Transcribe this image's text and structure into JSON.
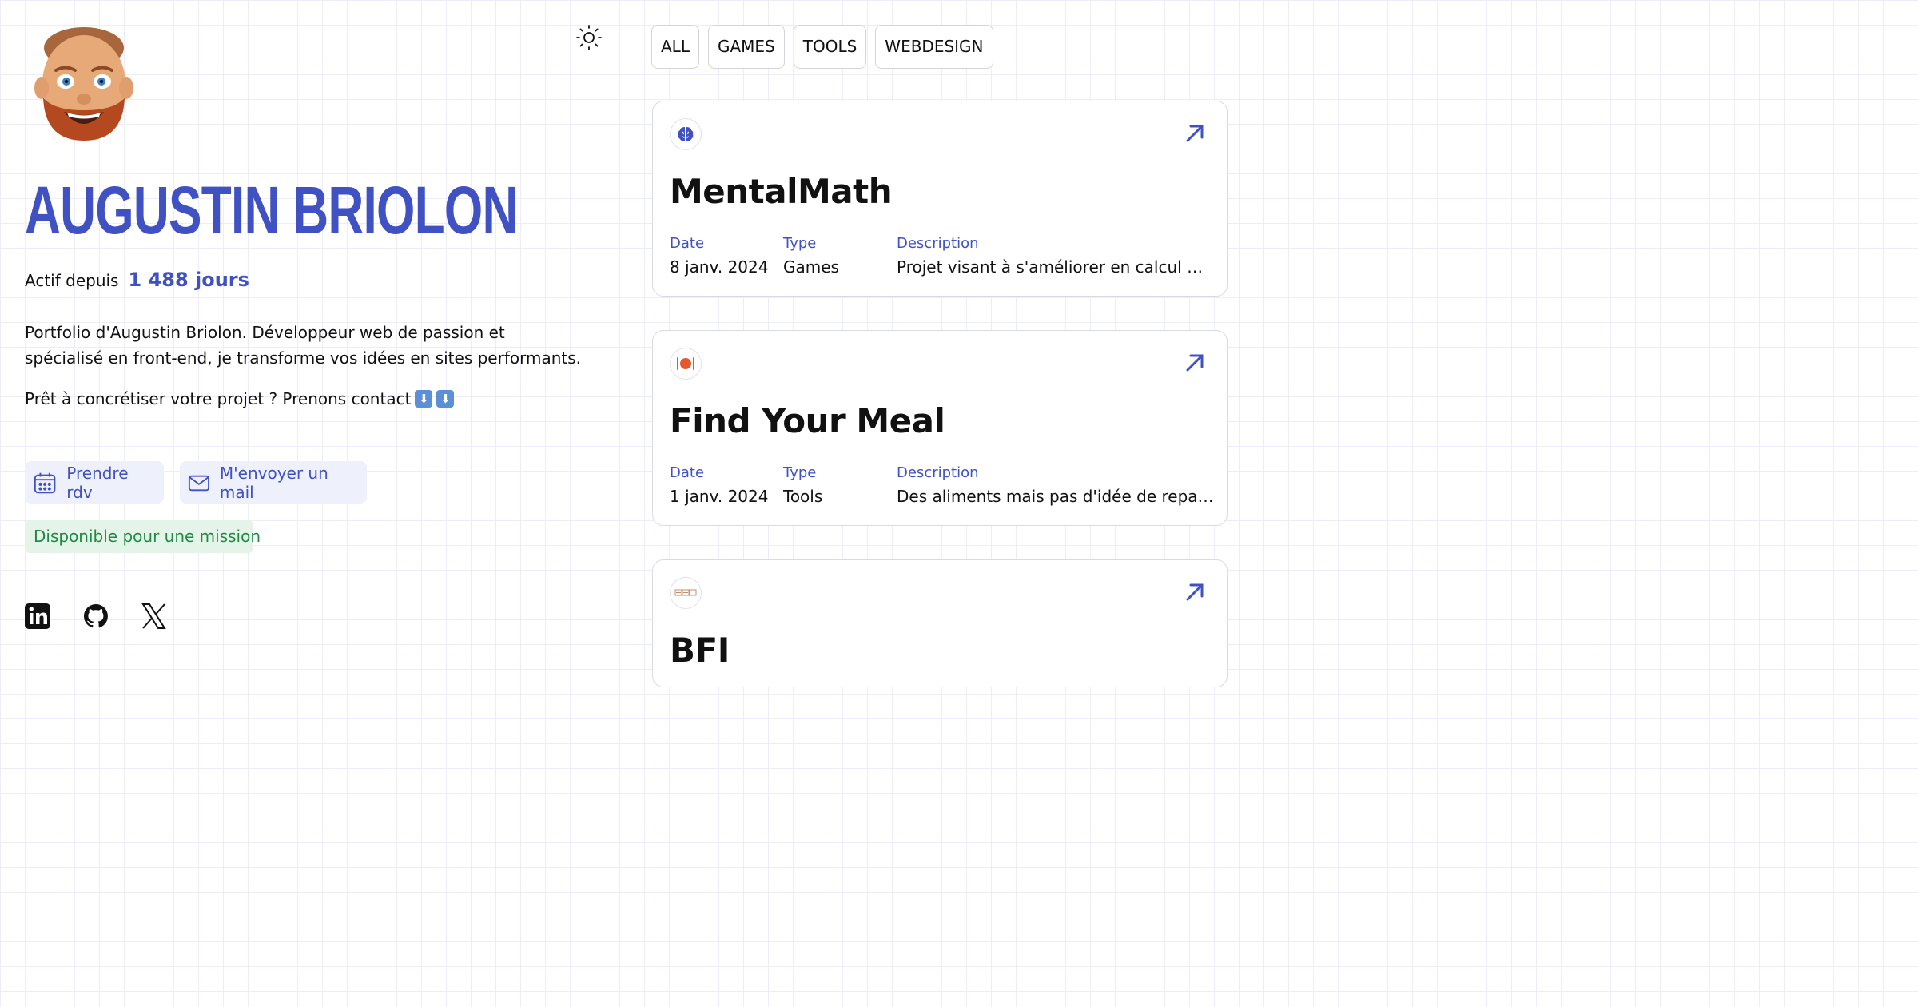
{
  "profile": {
    "name": "AUGUSTIN BRIOLON",
    "since_label": "Actif depuis",
    "since_value": "1 488 jours",
    "bio": "Portfolio d'Augustin Briolon. Développeur web de passion et spécialisé en front-end, je transforme vos idées en sites performants.",
    "cta_text": "Prêt à concrétiser votre projet ? Prenons contact",
    "cta_emoji": "⬇",
    "book_label": "Prendre rdv",
    "mail_label": "M'envoyer un mail",
    "availability": "Disponible pour une mission"
  },
  "social": [
    "linkedin-icon",
    "github-icon",
    "x-icon"
  ],
  "theme_toggle_icon": "sun-icon",
  "filters": [
    "ALL",
    "GAMES",
    "TOOLS",
    "WEBDESIGN"
  ],
  "labels": {
    "date": "Date",
    "type": "Type",
    "description": "Description"
  },
  "projects": [
    {
      "icon": "brain-icon",
      "title": "MentalMath",
      "date": "8 janv. 2024",
      "type": "Games",
      "description": "Projet visant à s'améliorer en calcul mental rapidement."
    },
    {
      "icon": "plate-icon",
      "title": "Find Your Meal",
      "date": "1 janv. 2024",
      "type": "Tools",
      "description": "Des aliments mais pas d'idée de repas ? Trouvez une recette."
    },
    {
      "icon": "logo-icon",
      "title": "BFI"
    }
  ],
  "colors": {
    "accent": "#3f51c3",
    "available_bg": "#e5f4e8",
    "available_text": "#1f8a46",
    "button_bg": "#eef0fb"
  }
}
